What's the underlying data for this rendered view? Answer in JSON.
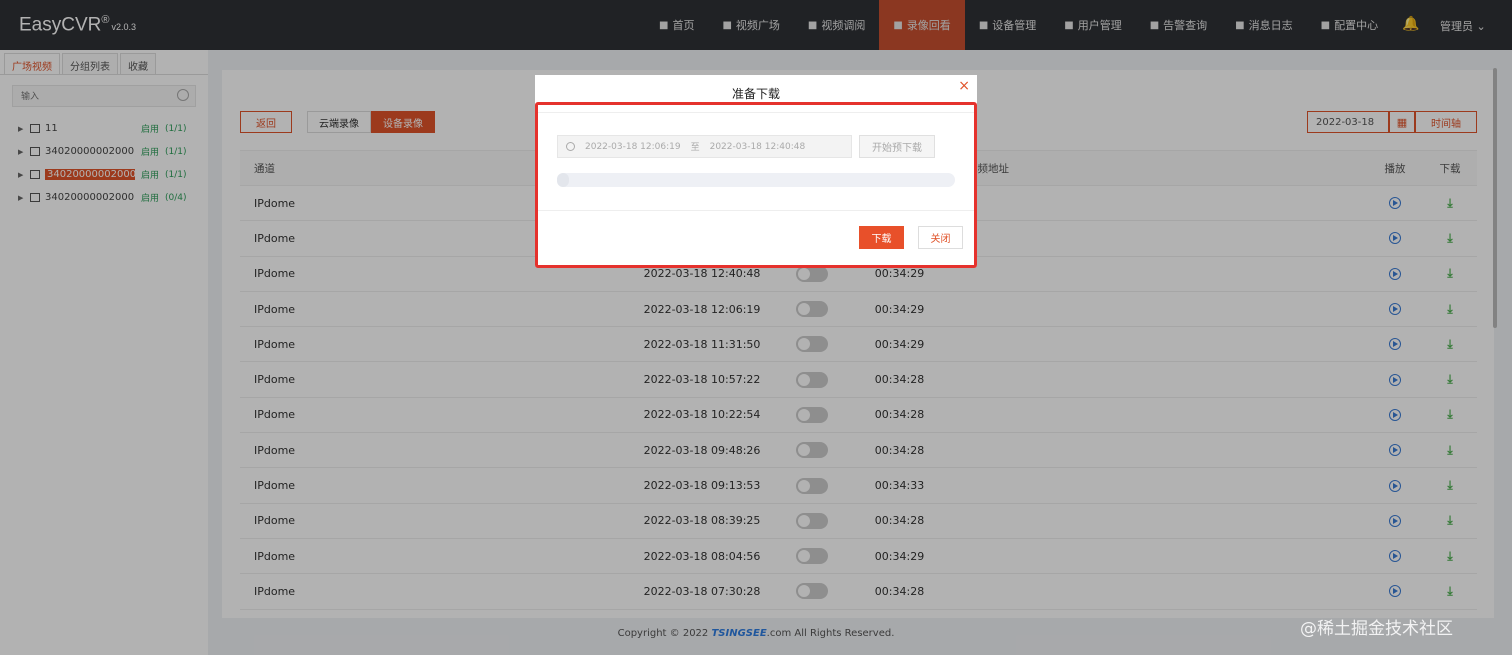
{
  "header": {
    "brand": "EasyCVR",
    "brand_mark": "®",
    "version": "v2.0.3",
    "nav": [
      {
        "label": "首页",
        "icon": "dashboard-icon"
      },
      {
        "label": "视频广场",
        "icon": "play-circle-icon"
      },
      {
        "label": "视频调阅",
        "icon": "video-grid-icon"
      },
      {
        "label": "录像回看",
        "icon": "camera-icon",
        "active": true
      },
      {
        "label": "设备管理",
        "icon": "device-icon"
      },
      {
        "label": "用户管理",
        "icon": "user-icon"
      },
      {
        "label": "告警查询",
        "icon": "alarm-icon"
      },
      {
        "label": "消息日志",
        "icon": "bell-small-icon"
      },
      {
        "label": "配置中心",
        "icon": "gear-icon"
      }
    ],
    "user": "管理员 ⌄"
  },
  "sidebar": {
    "tabs": [
      "广场视频",
      "分组列表",
      "收藏"
    ],
    "search_placeholder": "输入",
    "items": [
      {
        "name": "11",
        "status": "启用",
        "count": "(1/1)"
      },
      {
        "name": "34020000002000...",
        "status": "启用",
        "count": "(1/1)"
      },
      {
        "name": "34020000002000...",
        "status": "启用",
        "count": "(1/1)",
        "selected": true
      },
      {
        "name": "34020000002000...",
        "status": "启用",
        "count": "(0/4)"
      }
    ]
  },
  "toolbar": {
    "back": "返回",
    "cloud": "云端录像",
    "device": "设备录像",
    "date": "2022-03-18",
    "timeline": "时间轴"
  },
  "table": {
    "headers": {
      "channel": "通道",
      "url": "视频地址",
      "play": "播放",
      "download": "下载"
    },
    "rows": [
      {
        "channel": "IPdome",
        "time": "",
        "duration": ""
      },
      {
        "channel": "IPdome",
        "time": "",
        "duration": ""
      },
      {
        "channel": "IPdome",
        "time": "2022-03-18 12:40:48",
        "duration": "00:34:29"
      },
      {
        "channel": "IPdome",
        "time": "2022-03-18 12:06:19",
        "duration": "00:34:29"
      },
      {
        "channel": "IPdome",
        "time": "2022-03-18 11:31:50",
        "duration": "00:34:29"
      },
      {
        "channel": "IPdome",
        "time": "2022-03-18 10:57:22",
        "duration": "00:34:28"
      },
      {
        "channel": "IPdome",
        "time": "2022-03-18 10:22:54",
        "duration": "00:34:28"
      },
      {
        "channel": "IPdome",
        "time": "2022-03-18 09:48:26",
        "duration": "00:34:28"
      },
      {
        "channel": "IPdome",
        "time": "2022-03-18 09:13:53",
        "duration": "00:34:33"
      },
      {
        "channel": "IPdome",
        "time": "2022-03-18 08:39:25",
        "duration": "00:34:28"
      },
      {
        "channel": "IPdome",
        "time": "2022-03-18 08:04:56",
        "duration": "00:34:29"
      },
      {
        "channel": "IPdome",
        "time": "2022-03-18 07:30:28",
        "duration": "00:34:28"
      }
    ]
  },
  "footer": {
    "prefix": "Copyright © 2022",
    "logo": "TSINGSEE",
    "suffix": ".com All Rights Reserved."
  },
  "modal": {
    "title": "准备下载",
    "close": "×",
    "start": "2022-03-18 12:06:19",
    "to": "至",
    "end": "2022-03-18 12:40:48",
    "pre_download": "开始预下载",
    "progress": 0.03,
    "download": "下载",
    "close_btn": "关闭"
  },
  "watermark": "@稀土掘金技术社区",
  "colors": {
    "accent": "#e0532a",
    "highlight_frame": "#e5322d",
    "nav_bg": "#2f3135"
  }
}
